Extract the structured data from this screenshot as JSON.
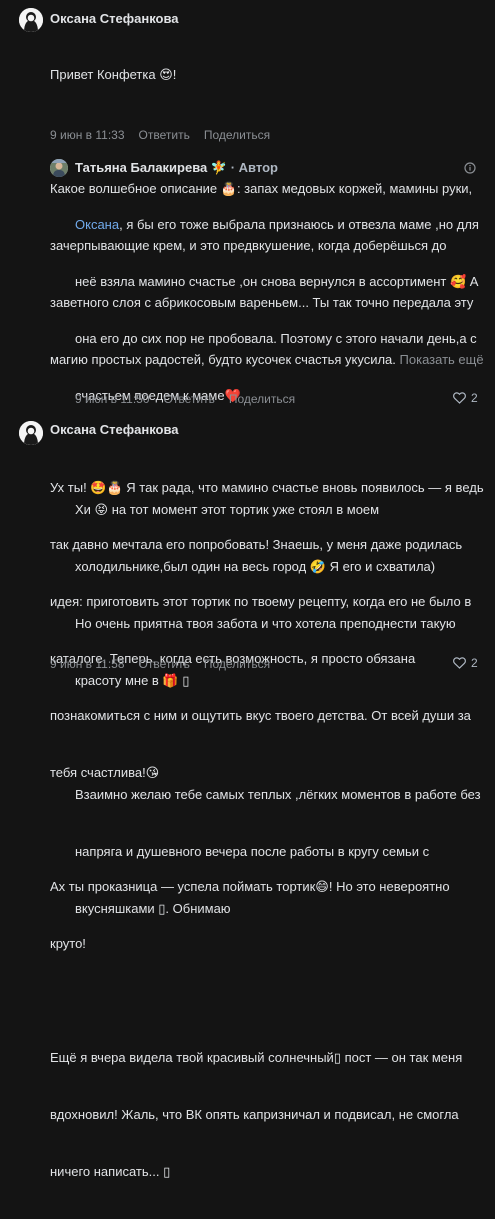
{
  "comments": [
    {
      "author": "Оксана Стефанкова",
      "text_lines": [
        "Привет Конфетка 😍!",
        "",
        "Какое волшебное описание 🎂: запах медовых коржей, мамины руки,",
        "зачерпывающие крем, и это предвкушение, когда доберёшься до",
        "заветного слоя с абрикосовым вареньем... Ты так точно передала эту",
        "магию простых радостей, будто кусочек счастья укусила."
      ],
      "more_label": "Показать ещё",
      "time": "9 июн в 11:33",
      "reply_label": "Ответить",
      "share_label": "Поделиться"
    },
    {
      "author": "Татьяна Балакирева",
      "author_emoji": "🧚",
      "role": "· Автор",
      "mention": "Оксана",
      "text_line1_rest": ", я бы его тоже выбрала признаюсь и отвезла маме ,но для",
      "text_lines": [
        "неё взяла мамино счастье ,он снова вернулся в ассортимент 🥰 А",
        "она его до сих пор не пробовала. Поэтому с этого начали день,а с",
        "счастьем поедем к маме❤️",
        "",
        "Хи 😝 на тот момент этот тортик уже стоял в моем",
        "холодильнике,был один на весь город 🤣 Я его и схватила)",
        "Но очень приятна твоя забота и что хотела преподнести такую",
        "красоту мне в 🎁 ▯",
        "",
        "Взаимно желаю тебе самых теплых ,лёгких моментов в работе без",
        "напряга и душевного вечера после работы в кругу семьи с",
        "вкусняшками ▯. Обнимаю"
      ],
      "time": "9 июн в 11:50",
      "reply_label": "Ответить",
      "share_label": "Поделиться",
      "likes": "2"
    },
    {
      "author": "Оксана Стефанкова",
      "text_lines": [
        "Ух ты! 🤩🎂 Я так рада, что мамино счастье вновь появилось — я ведь",
        "так давно мечтала его попробовать! Знаешь, у меня даже родилась",
        "идея: приготовить этот тортик по твоему рецепту, когда его не было в",
        "каталоге. Теперь, когда есть возможность, я просто обязана",
        "познакомиться с ним и ощутить вкус твоего детства. От всей души за",
        "тебя счастлива!😘",
        "",
        "Ах ты проказница — успела поймать тортик😄! Но это невероятно",
        "круто!",
        "",
        "Ещё я вчера видела твой красивый солнечный▯ пост — он так меня",
        "вдохновил! Жаль, что ВК опять капризничал и подвисал, не смогла",
        "ничего написать... ▯"
      ],
      "time": "9 июн в 11:58",
      "reply_label": "Ответить",
      "share_label": "Поделиться",
      "likes": "2"
    }
  ],
  "colors": {
    "background": "#141414",
    "text": "#e1e3e6",
    "secondary": "#8b8f94",
    "mention": "#71aaeb"
  }
}
